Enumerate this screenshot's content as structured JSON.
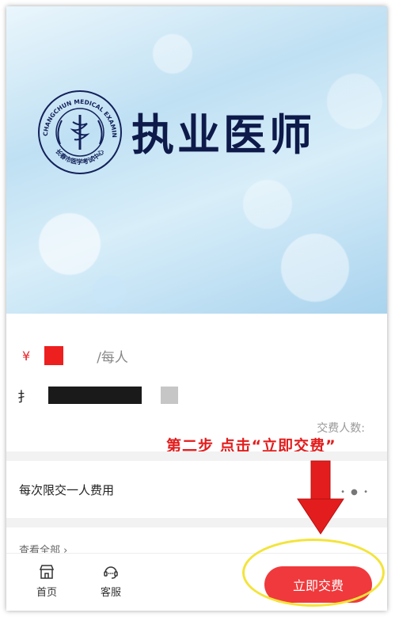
{
  "banner": {
    "title": "执业医师",
    "emblem_ring_text": "CHANGCHUN MEDICAL EXAMINATION CENTER",
    "emblem_cn_text": "长春市医学考试中心"
  },
  "product": {
    "price_symbol": "¥",
    "price_unit": "/每人",
    "title_prefix": "扌",
    "payers_label": "交费人数:"
  },
  "annotation": {
    "step_text": "第二步 点击“立即交费”",
    "color": "#e31d1d"
  },
  "limit": {
    "text": "每次限交一人费用"
  },
  "list": {
    "view_all": "查看全部 ›"
  },
  "bottom_nav": {
    "home_label": "首页",
    "service_label": "客服",
    "pay_label": "立即交费"
  },
  "colors": {
    "accent": "#f0393c",
    "highlight": "#f3e43a",
    "title": "#0d1a4a"
  }
}
